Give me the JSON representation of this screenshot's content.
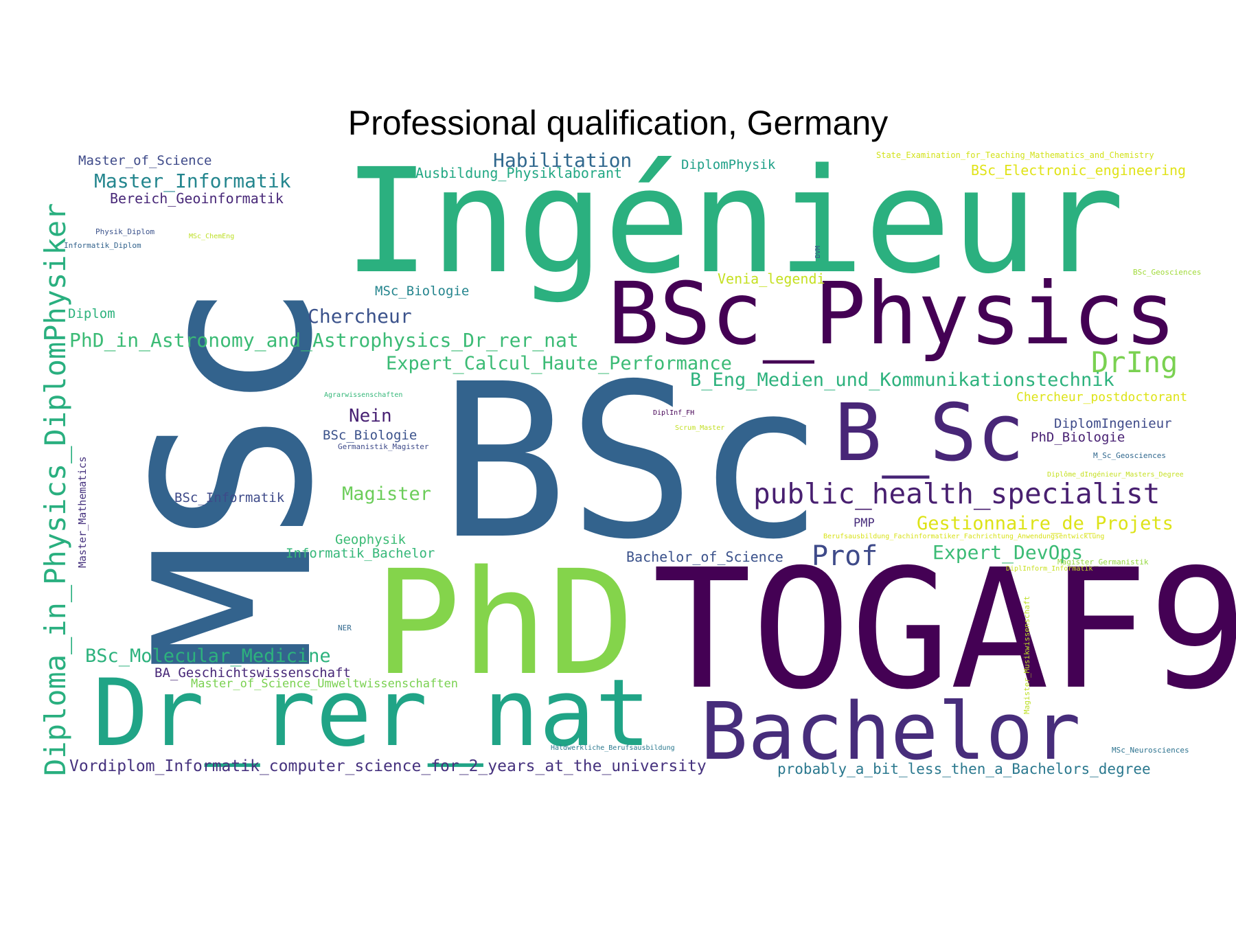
{
  "title": "Professional qualification, Germany",
  "words": [
    {
      "text": "Ingénieur",
      "color": "#2bb07f"
    },
    {
      "text": "MSc",
      "color": "#33638d"
    },
    {
      "text": "BSc",
      "color": "#33638d"
    },
    {
      "text": "TOGAF9",
      "color": "#440154"
    },
    {
      "text": "PhD",
      "color": "#84d44b"
    },
    {
      "text": "BSc_Physics",
      "color": "#440154"
    },
    {
      "text": "Dr_rer_nat",
      "color": "#20a486"
    },
    {
      "text": "Bachelor",
      "color": "#472d7b"
    },
    {
      "text": "B_Sc",
      "color": "#482677"
    },
    {
      "text": "Diploma_in_Physics_DiplomPhysiker",
      "color": "#29af7f"
    },
    {
      "text": "public_health_specialist",
      "color": "#481f70"
    },
    {
      "text": "Habilitation",
      "color": "#31688e"
    },
    {
      "text": "Master_Informatik",
      "color": "#24868e"
    },
    {
      "text": "Chercheur",
      "color": "#3b528b"
    },
    {
      "text": "PhD_in_Astronomy_and_Astrophysics_Dr_rer_nat",
      "color": "#3bbb75"
    },
    {
      "text": "Expert_Calcul_Haute_Performance",
      "color": "#3bbb75"
    },
    {
      "text": "DrIng",
      "color": "#7ad151"
    },
    {
      "text": "B_Eng_Medien_und_Kommunikationstechnik",
      "color": "#2db27d"
    },
    {
      "text": "Gestionnaire_de_Projets",
      "color": "#dde318"
    },
    {
      "text": "Prof",
      "color": "#3e4a89"
    },
    {
      "text": "Expert_DevOps",
      "color": "#3bbb75"
    },
    {
      "text": "BSc_Molecular_Medicine",
      "color": "#2db27d"
    },
    {
      "text": "Vordiplom_Informatik_computer_science_for_2_years_at_the_university",
      "color": "#46327e"
    },
    {
      "text": "probably_a_bit_less_then_a_Bachelors_degree",
      "color": "#2a788e"
    },
    {
      "text": "Nein",
      "color": "#482173"
    },
    {
      "text": "Magister",
      "color": "#6ccd5a"
    },
    {
      "text": "Master_of_Science",
      "color": "#3e4a89"
    },
    {
      "text": "Bereich_Geoinformatik",
      "color": "#482878"
    },
    {
      "text": "Ausbildung_Physiklaborant",
      "color": "#22a884"
    },
    {
      "text": "DiplomPhysik",
      "color": "#1fa088"
    },
    {
      "text": "BSc_Electronic_engineering",
      "color": "#e0e318"
    },
    {
      "text": "State_Examination_for_Teaching_Mathematics_and_Chemistry",
      "color": "#d2e21b"
    },
    {
      "text": "MSc_Biologie",
      "color": "#25858e"
    },
    {
      "text": "Venia_legendi",
      "color": "#c5e021"
    },
    {
      "text": "Diplom",
      "color": "#2db27d"
    },
    {
      "text": "BSc_Biologie",
      "color": "#3b528b"
    },
    {
      "text": "BSc_Informatik",
      "color": "#3e4a89"
    },
    {
      "text": "Geophysik",
      "color": "#3bbb75"
    },
    {
      "text": "Informatik_Bachelor",
      "color": "#35b779"
    },
    {
      "text": "Bachelor_of_Science",
      "color": "#3b528b"
    },
    {
      "text": "Chercheur_postdoctorant",
      "color": "#dde318"
    },
    {
      "text": "DiplomIngenieur",
      "color": "#3e4a89"
    },
    {
      "text": "PhD_Biologie",
      "color": "#482173"
    },
    {
      "text": "BA_Geschichtswissenschaft",
      "color": "#482878"
    },
    {
      "text": "Master_of_Science_Umweltwissenschaften",
      "color": "#7ad151"
    },
    {
      "text": "Master_Mathematics",
      "color": "#46327e"
    },
    {
      "text": "PMP",
      "color": "#472d7b"
    },
    {
      "text": "Physik_Diplom",
      "color": "#3b528b"
    },
    {
      "text": "Informatik_Diplom",
      "color": "#33638d"
    },
    {
      "text": "MSc_ChemEng",
      "color": "#bddf26"
    },
    {
      "text": "DVM",
      "color": "#3b528b"
    },
    {
      "text": "BSc_Geosciences",
      "color": "#a0da39"
    },
    {
      "text": "Agrarwissenschaften",
      "color": "#35b779"
    },
    {
      "text": "Germanistik_Magister",
      "color": "#3e4a89"
    },
    {
      "text": "DiplInf_FH",
      "color": "#440154"
    },
    {
      "text": "Scrum_Master",
      "color": "#c2df23"
    },
    {
      "text": "M_Sc_Geosciences",
      "color": "#31688e"
    },
    {
      "text": "Diplôme_dIngénieur_Masters_Degree",
      "color": "#c5e021"
    },
    {
      "text": "Berufsausbildung_Fachinformatiker_Fachrichtung_Anwendungsentwicklung",
      "color": "#d8e219"
    },
    {
      "text": "DiplInform_Informatik",
      "color": "#c8e020"
    },
    {
      "text": "Magister_Germanistik",
      "color": "#95d840"
    },
    {
      "text": "Magister_Musikwissenschaft",
      "color": "#bddf26"
    },
    {
      "text": "NER",
      "color": "#31688e"
    },
    {
      "text": "Haldwerkliche_Berufsausbildung",
      "color": "#2a788e"
    },
    {
      "text": "MSc_Neurosciences",
      "color": "#2c728e"
    }
  ]
}
